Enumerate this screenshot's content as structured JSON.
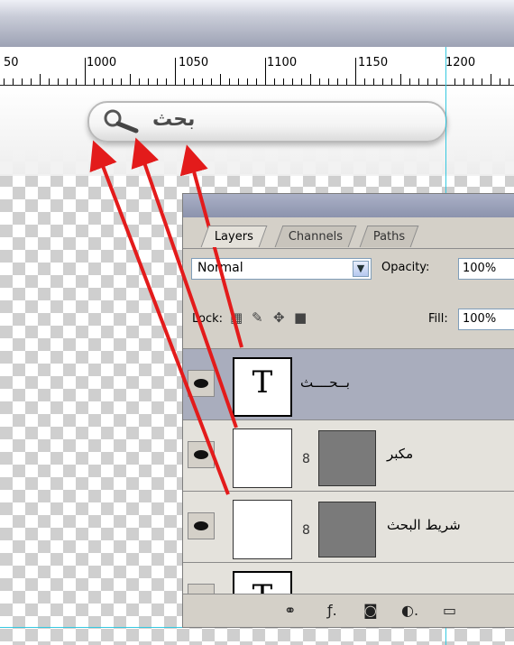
{
  "ruler": {
    "labels": [
      "50",
      "1000",
      "1050",
      "1100",
      "1150",
      "1200"
    ]
  },
  "search_bar": {
    "text": "بحث",
    "icon": "magnifier-icon"
  },
  "layers_panel": {
    "tabs": [
      {
        "label": "Layers"
      },
      {
        "label": "Channels"
      },
      {
        "label": "Paths"
      }
    ],
    "blend_mode": "Normal",
    "opacity_label": "Opacity:",
    "opacity_value": "100%",
    "lock_label": "Lock:",
    "fill_label": "Fill:",
    "fill_value": "100%",
    "layers": [
      {
        "name": "بــحــــث",
        "thumb": "T"
      },
      {
        "name": "مكبر"
      },
      {
        "name": "شريط البحث"
      },
      {
        "name": "",
        "thumb": "T"
      }
    ]
  },
  "colors": {
    "arrow": "#e31b1b",
    "guide": "#35c8e0",
    "selected_layer": "#a9adbd"
  }
}
